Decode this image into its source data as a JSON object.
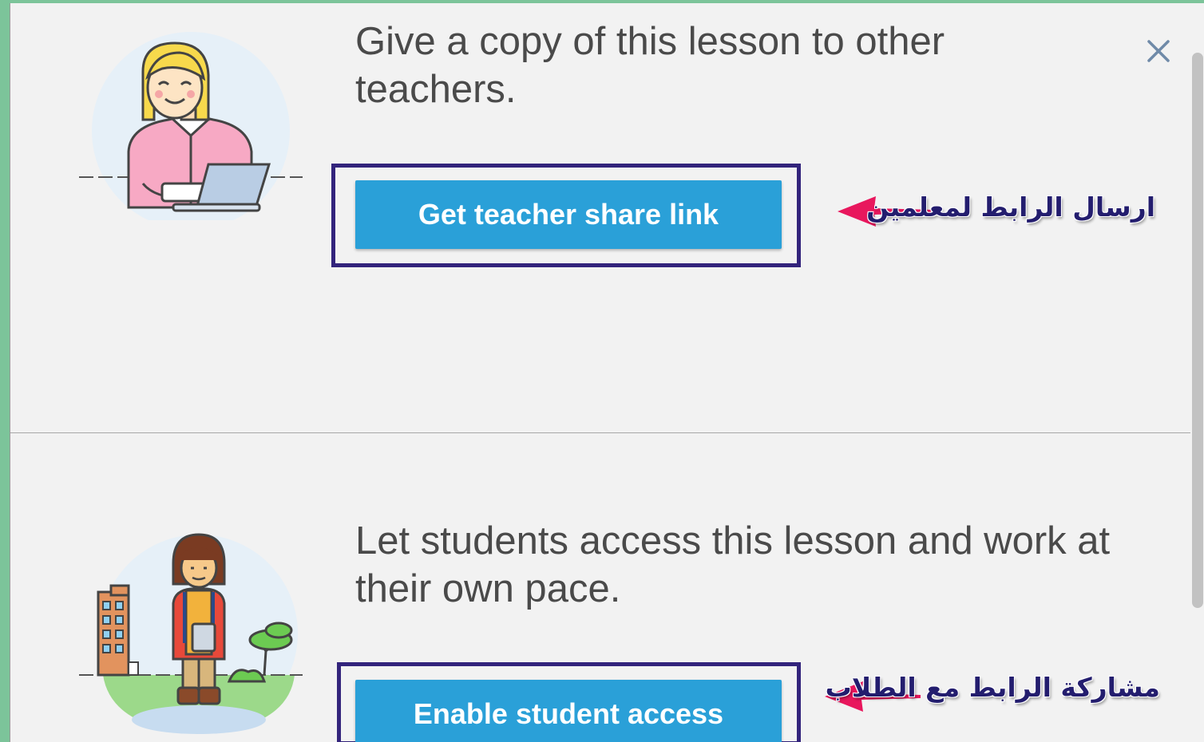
{
  "dialog": {
    "close_icon": "close-icon",
    "teacher_section": {
      "description": "Give a copy of this lesson to other teachers.",
      "button_label": "Get teacher share link",
      "annotation": "ارسال الرابط لمعلمين",
      "illustration": "teacher-with-laptop-illustration"
    },
    "student_section": {
      "description": "Let students access this lesson and work at their own pace.",
      "button_label": "Enable student access",
      "annotation": "مشاركة الرابط مع الطلاب",
      "illustration": "student-with-tablet-illustration"
    }
  },
  "colors": {
    "button": "#2aa0d8",
    "highlight_border": "#33247c",
    "annotation_arrow": "#e8175d",
    "annotation_text": "#231d6e",
    "background": "#f2f2f2"
  }
}
